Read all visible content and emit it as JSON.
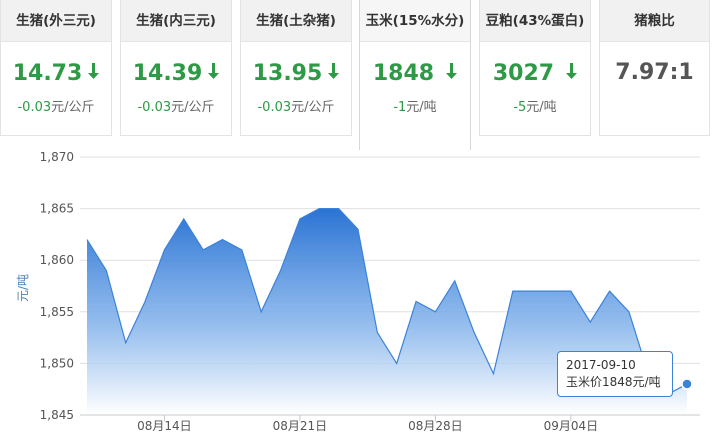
{
  "cards": [
    {
      "title": "生猪(外三元)",
      "value": "14.73",
      "arrow": "down",
      "change": "-0.03",
      "unit": "元/公斤"
    },
    {
      "title": "生猪(内三元)",
      "value": "14.39",
      "arrow": "down",
      "change": "-0.03",
      "unit": "元/公斤"
    },
    {
      "title": "生猪(土杂猪)",
      "value": "13.95",
      "arrow": "down",
      "change": "-0.03",
      "unit": "元/公斤"
    },
    {
      "title": "玉米(15%水分)",
      "value": "1848",
      "arrow": "down",
      "change": "-1",
      "unit": "元/吨"
    },
    {
      "title": "豆粕(43%蛋白)",
      "value": "3027",
      "arrow": "down",
      "change": "-5",
      "unit": "元/吨"
    },
    {
      "title": "猪粮比",
      "value": "7.97:1",
      "arrow": "",
      "change": "",
      "unit": ""
    }
  ],
  "colors": {
    "up_down_green": "#2e9a45",
    "series_blue": "#3b82d9"
  },
  "chart_data": {
    "type": "area",
    "ylabel": "元/吨",
    "ylim": [
      1845,
      1870
    ],
    "yticks": [
      "1,845",
      "1,850",
      "1,855",
      "1,860",
      "1,865",
      "1,870"
    ],
    "ytick_values": [
      1845,
      1850,
      1855,
      1860,
      1865,
      1870
    ],
    "xticks": [
      {
        "label": "08月14日",
        "date": "2017-08-14"
      },
      {
        "label": "08月21日",
        "date": "2017-08-21"
      },
      {
        "label": "08月28日",
        "date": "2017-08-28"
      },
      {
        "label": "09月04日",
        "date": "2017-09-04"
      }
    ],
    "dates": [
      "2017-08-10",
      "2017-08-11",
      "2017-08-12",
      "2017-08-13",
      "2017-08-14",
      "2017-08-15",
      "2017-08-16",
      "2017-08-17",
      "2017-08-18",
      "2017-08-19",
      "2017-08-20",
      "2017-08-21",
      "2017-08-22",
      "2017-08-23",
      "2017-08-24",
      "2017-08-25",
      "2017-08-26",
      "2017-08-27",
      "2017-08-28",
      "2017-08-29",
      "2017-08-30",
      "2017-08-31",
      "2017-09-01",
      "2017-09-02",
      "2017-09-03",
      "2017-09-04",
      "2017-09-05",
      "2017-09-06",
      "2017-09-07",
      "2017-09-08",
      "2017-09-09",
      "2017-09-10"
    ],
    "values": [
      1862,
      1859,
      1852,
      1856,
      1861,
      1864,
      1861,
      1862,
      1861,
      1855,
      1859,
      1864,
      1865,
      1865,
      1863,
      1853,
      1850,
      1856,
      1855,
      1858,
      1853,
      1849,
      1857,
      1857,
      1857,
      1857,
      1854,
      1857,
      1855,
      1849,
      1847,
      1848
    ],
    "tooltip": {
      "date": "2017-09-10",
      "text": "玉米价1848元/吨"
    }
  }
}
